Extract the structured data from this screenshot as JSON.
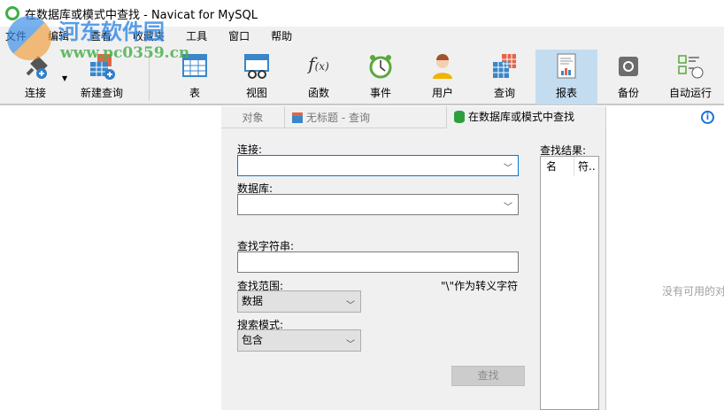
{
  "window": {
    "title": "在数据库或模式中查找 - Navicat for MySQL"
  },
  "watermark": {
    "name": "河东软件园",
    "url": "www.pc0359.cn"
  },
  "menu": [
    "文件",
    "编辑",
    "查看",
    "收藏夹",
    "工具",
    "窗口",
    "帮助"
  ],
  "toolbar": [
    {
      "label": "连接",
      "icon": "connect-plug-icon"
    },
    {
      "label": "新建查询",
      "icon": "new-query-icon"
    },
    {
      "label": "表",
      "icon": "table-icon"
    },
    {
      "label": "视图",
      "icon": "view-icon"
    },
    {
      "label": "函数",
      "icon": "function-icon"
    },
    {
      "label": "事件",
      "icon": "event-clock-icon"
    },
    {
      "label": "用户",
      "icon": "user-icon"
    },
    {
      "label": "查询",
      "icon": "query-icon"
    },
    {
      "label": "报表",
      "icon": "report-icon",
      "selected": true
    },
    {
      "label": "备份",
      "icon": "backup-icon"
    },
    {
      "label": "自动运行",
      "icon": "automation-icon"
    }
  ],
  "tabs": [
    {
      "label": "对象"
    },
    {
      "label": "无标题 - 查询"
    },
    {
      "label": "在数据库或模式中查找",
      "active": true
    }
  ],
  "form": {
    "connection_label": "连接:",
    "connection_value": "",
    "database_label": "数据库:",
    "database_value": "",
    "search_string_label": "查找字符串:",
    "search_string_value": "",
    "escape_hint": "\"\\\"作为转义字符",
    "scope_label": "查找范围:",
    "scope_value": "数据",
    "mode_label": "搜索模式:",
    "mode_value": "包含",
    "find_button": "查找"
  },
  "results": {
    "label": "查找结果:",
    "columns": [
      "名",
      "符.."
    ]
  },
  "right": {
    "empty_text": "没有可用的对"
  }
}
